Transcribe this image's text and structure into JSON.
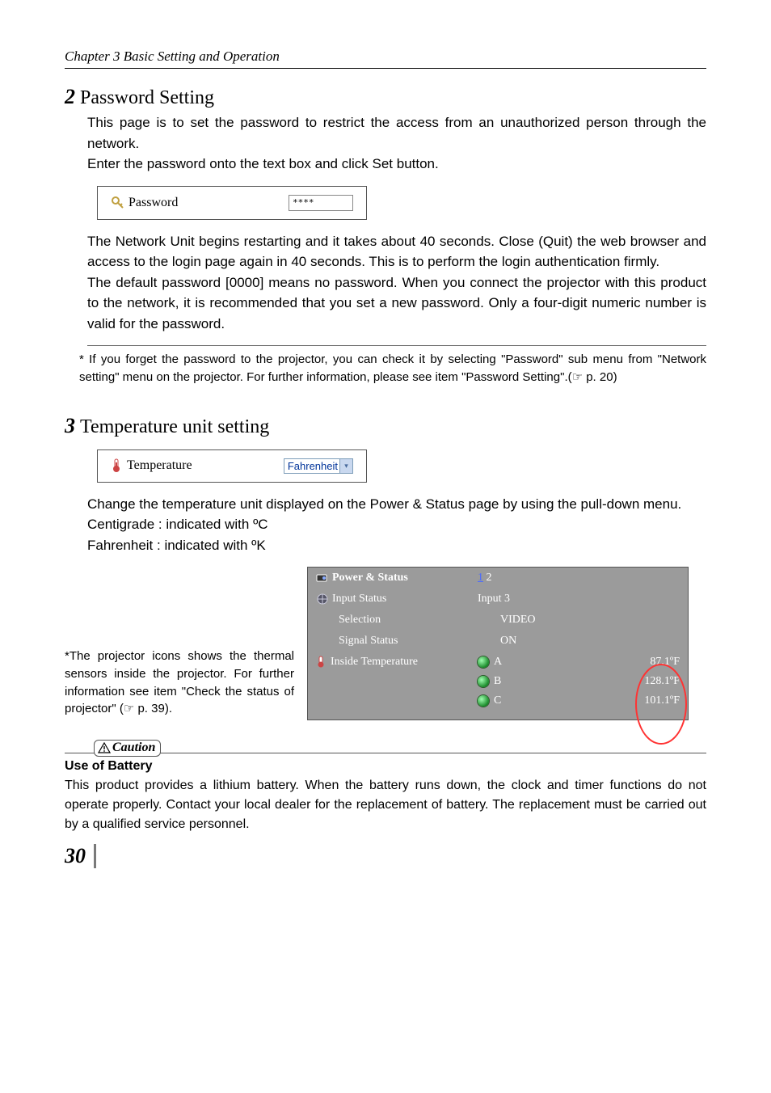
{
  "chapter_header": "Chapter 3 Basic Setting and Operation",
  "section2": {
    "num": "2",
    "title": "Password Setting",
    "p1": "This page is to set the password to restrict the access from an unauthorized person through the network.",
    "p2_pre": "Enter the password onto the text box and click ",
    "p2_btn": "Set",
    "p2_post": " button.",
    "field_label": "Password",
    "field_value": "****",
    "p3": "The Network Unit begins restarting and it takes about 40 seconds. Close (Quit) the web browser and access to the login page again in 40 seconds. This is to perform the login authentication firmly.",
    "p4": "The default password [0000] means no password.  When you connect the projector with this product to the network, it is recommended that you set a new password. Only a four-digit numeric number is valid for the password.",
    "footnote": "* If you forget the password to the projector, you can check it by selecting \"Password\" sub menu from \"Network setting\" menu on the projector. For further information, please see item \"Password Setting\".(☞ p. 20)"
  },
  "section3": {
    "num": "3",
    "title": "Temperature unit setting",
    "field_label": "Temperature",
    "field_value": "Fahrenheit",
    "p1": "Change the temperature unit displayed on the Power & Status page by using the pull-down  menu.",
    "p2": "Centigrade : indicated with ºC",
    "p3": "Fahrenheit : indicated with ºK"
  },
  "aside": "*The projector icons shows the thermal sensors inside the projector. For further information see item \"Check the status of projector\" (☞ p. 39).",
  "status_panel": {
    "title": "Power & Status",
    "pager_link": "1",
    "pager_rest": " 2",
    "rows": [
      {
        "label": "Input Status",
        "value": "Input 3"
      },
      {
        "label": "Selection",
        "value": "VIDEO"
      },
      {
        "label": "Signal Status",
        "value": "ON"
      }
    ],
    "inside_label": "Inside Temperature",
    "temps": [
      {
        "id": "A",
        "val": "87.1ºF"
      },
      {
        "id": "B",
        "val": "128.1ºF"
      },
      {
        "id": "C",
        "val": "101.1ºF"
      }
    ]
  },
  "caution_label": "Caution",
  "battery": {
    "heading": "Use of Battery",
    "text": "This product provides a lithium battery. When the battery runs down, the clock and timer functions do not operate properly. Contact your local dealer for the replacement of battery. The replacement must be carried out by a qualified service personnel."
  },
  "page_number": "30"
}
